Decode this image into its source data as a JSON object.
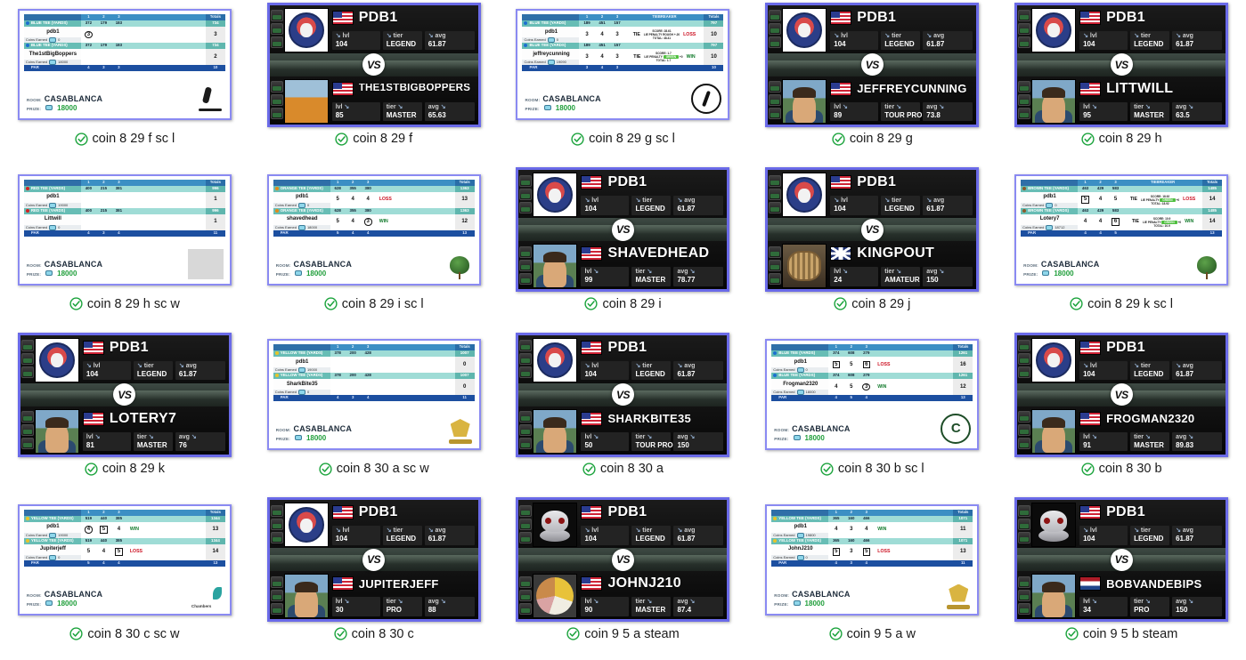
{
  "page": {
    "title": "Thumbnail grid of golf match screenshots",
    "rows": 4,
    "columns": 5,
    "accent_border": "#7b7bf0",
    "check_color": "#1ba33c"
  },
  "common": {
    "room_key": "ROOM:",
    "prize_key": "PRIZE:",
    "room": "CASABLANCA",
    "prize": "18000",
    "hole_headers": [
      "1",
      "2",
      "3"
    ],
    "totals_header": "Totals",
    "tiebreaker_header": "TIEBREAKER",
    "par_label": "PAR",
    "coins_label": "Coins Earned",
    "lvl_key": "lvl",
    "tier_key": "tier",
    "avg_key": "avg",
    "vs_label": "VS",
    "win": "WIN",
    "loss": "LOSS",
    "tie": "TIE"
  },
  "me": {
    "name": "PDB1",
    "name_lower": "pdb1",
    "flag": "us",
    "lvl": "104",
    "tier": "LEGEND",
    "avg": "61.87"
  },
  "items": [
    {
      "caption": "coin 8 29 f sc l",
      "type": "scorecard",
      "tee": "BLUE TEE (YARDS)",
      "tee_color": "#1d6fd0",
      "tiebreaker": false,
      "yards": [
        "372",
        "179",
        "183"
      ],
      "yards_total": "734",
      "par": [
        "4",
        "3",
        "3"
      ],
      "par_total": "10",
      "logo": "golfer",
      "players": [
        {
          "name": "pdb1",
          "scores": [
            "3",
            "",
            ""
          ],
          "marks": [
            "circle",
            "",
            ""
          ],
          "result": "",
          "total": "3",
          "coins": "0"
        },
        {
          "name": "The1stBigBoppers",
          "scores": [
            "",
            "",
            ""
          ],
          "marks": [
            "",
            "",
            ""
          ],
          "result": "",
          "total": "2",
          "coins": "18000"
        }
      ]
    },
    {
      "caption": "coin 8 29 f",
      "type": "vs",
      "avatar_me": "logo",
      "opponent": {
        "name": "THE1STBIGBOPPERS",
        "flag": "us",
        "lvl": "85",
        "tier": "MASTER",
        "avg": "65.63",
        "avatar": "monk"
      }
    },
    {
      "caption": "coin 8 29 g sc l",
      "type": "scorecard",
      "tee": "BLUE TEE (YARDS)",
      "tee_color": "#1d6fd0",
      "tiebreaker": true,
      "yards": [
        "189",
        "451",
        "157"
      ],
      "yards_total": "797",
      "par": [
        "3",
        "4",
        "3"
      ],
      "par_total": "10",
      "logo": "tiger",
      "players": [
        {
          "name": "pdb1",
          "scores": [
            "3",
            "4",
            "3"
          ],
          "marks": [
            "",
            "",
            ""
          ],
          "result": "LOSS",
          "tie": "TIE",
          "tb": [
            "SCORE: 28.61",
            "LIE PENALTY  ROUGH  +.20",
            "TOTAL: 48.41"
          ],
          "tb_pill": "",
          "total": "10",
          "coins": "0"
        },
        {
          "name": "jeffreycunning",
          "scores": [
            "3",
            "4",
            "3"
          ],
          "marks": [
            "",
            "",
            ""
          ],
          "result": "WIN",
          "tie": "TIE",
          "tb": [
            "SCORE: 1.7",
            "LIE PENALTY",
            "TOTAL: 1.7"
          ],
          "tb_pill": "GREEN",
          "total": "10",
          "coins": "19090"
        }
      ]
    },
    {
      "caption": "coin 8 29 g",
      "type": "vs",
      "avatar_me": "logo",
      "opponent": {
        "name": "JEFFREYCUNNING",
        "flag": "us",
        "lvl": "89",
        "tier": "TOUR PRO",
        "avg": "73.8",
        "avatar": "face"
      }
    },
    {
      "caption": "coin 8 29 h",
      "type": "vs",
      "avatar_me": "logo",
      "opponent": {
        "name": "LITTWILL",
        "flag": "us",
        "lvl": "95",
        "tier": "MASTER",
        "avg": "63.5",
        "avatar": "face"
      }
    },
    {
      "caption": "coin 8 29 h sc w",
      "type": "scorecard",
      "tee": "RED TEE (YARDS)",
      "tee_color": "#d02424",
      "tiebreaker": false,
      "yards": [
        "400",
        "215",
        "381"
      ],
      "yards_total": "996",
      "par": [
        "4",
        "3",
        "4"
      ],
      "par_total": "11",
      "logo": "blank",
      "players": [
        {
          "name": "pdb1",
          "scores": [
            "",
            "",
            ""
          ],
          "marks": [
            "",
            "",
            ""
          ],
          "result": "",
          "total": "1",
          "coins": "19000"
        },
        {
          "name": "Littwill",
          "scores": [
            "",
            "",
            ""
          ],
          "marks": [
            "",
            "",
            ""
          ],
          "result": "",
          "total": "1",
          "coins": "0"
        }
      ]
    },
    {
      "caption": "coin 8 29 i sc l",
      "type": "scorecard",
      "tee": "ORANGE TEE (YARDS)",
      "tee_color": "#e08a18",
      "tiebreaker": false,
      "yards": [
        "628",
        "355",
        "380"
      ],
      "yards_total": "1363",
      "par": [
        "5",
        "4",
        "4"
      ],
      "par_total": "13",
      "logo": "tree",
      "players": [
        {
          "name": "pdb1",
          "scores": [
            "5",
            "4",
            "4"
          ],
          "marks": [
            "",
            "",
            ""
          ],
          "result": "LOSS",
          "total": "13",
          "coins": "0"
        },
        {
          "name": "shavedhead",
          "scores": [
            "5",
            "4",
            "3"
          ],
          "marks": [
            "",
            "",
            "circle"
          ],
          "result": "WIN",
          "total": "12",
          "coins": "18000"
        }
      ]
    },
    {
      "caption": "coin 8 29 i",
      "type": "vs",
      "avatar_me": "logo",
      "opponent": {
        "name": "SHAVEDHEAD",
        "flag": "us",
        "lvl": "99",
        "tier": "MASTER",
        "avg": "78.77",
        "avatar": "face"
      }
    },
    {
      "caption": "coin 8 29 j",
      "type": "vs",
      "avatar_me": "logo",
      "opponent": {
        "name": "KINGPOUT",
        "flag": "uk",
        "lvl": "24",
        "tier": "AMATEUR",
        "avg": "150",
        "avatar": "king"
      }
    },
    {
      "caption": "coin 8 29 k sc l",
      "type": "scorecard",
      "tee": "BROWN TEE (YARDS)",
      "tee_color": "#8a5a2b",
      "tiebreaker": true,
      "yards": [
        "463",
        "429",
        "583"
      ],
      "yards_total": "1485",
      "par": [
        "4",
        "4",
        "5"
      ],
      "par_total": "13",
      "logo": "tree",
      "players": [
        {
          "name": "pdb1",
          "scores": [
            "5",
            "4",
            "5"
          ],
          "marks": [
            "box",
            "",
            ""
          ],
          "result": "LOSS",
          "tie": "TIE",
          "tb": [
            "SCORE: 18.92",
            "LIE PENALTY  GREEN  +0",
            "TOTAL: 18.92"
          ],
          "tb_pill": "GREEN",
          "total": "14",
          "coins": "0"
        },
        {
          "name": "Lotery7",
          "scores": [
            "4",
            "4",
            "6"
          ],
          "marks": [
            "",
            "",
            "box"
          ],
          "result": "WIN",
          "tie": "TIE",
          "tb": [
            "SCORE: 10.9",
            "LIE PENALTY  GREEN  +0",
            "TOTAL: 10.9"
          ],
          "tb_pill": "GREEN",
          "total": "14",
          "coins": "18712"
        }
      ]
    },
    {
      "caption": "coin 8 29 k",
      "type": "vs",
      "avatar_me": "logo",
      "opponent": {
        "name": "LOTERY7",
        "flag": "us",
        "lvl": "81",
        "tier": "MASTER",
        "avg": "76",
        "avatar": "face"
      }
    },
    {
      "caption": "coin 8 30 a sc w",
      "type": "scorecard",
      "tee": "YELLOW TEE (YARDS)",
      "tee_color": "#e8c428",
      "tiebreaker": false,
      "yards": [
        "378",
        "200",
        "428"
      ],
      "yards_total": "1007",
      "par": [
        "4",
        "3",
        "4"
      ],
      "par_total": "11",
      "logo": "crest",
      "players": [
        {
          "name": "pdb1",
          "scores": [
            "",
            "",
            ""
          ],
          "marks": [
            "",
            "",
            ""
          ],
          "result": "",
          "total": "0",
          "coins": "19000"
        },
        {
          "name": "SharkBite35",
          "scores": [
            "",
            "",
            ""
          ],
          "marks": [
            "",
            "",
            ""
          ],
          "result": "",
          "total": "0",
          "coins": "0"
        }
      ]
    },
    {
      "caption": "coin 8 30 a",
      "type": "vs",
      "avatar_me": "logo",
      "opponent": {
        "name": "SHARKBITE35",
        "flag": "us",
        "lvl": "50",
        "tier": "TOUR PRO",
        "avg": "150",
        "avatar": "face"
      }
    },
    {
      "caption": "coin 8 30 b sc l",
      "type": "scorecard",
      "tee": "BLUE TEE (YARDS)",
      "tee_color": "#1d6fd0",
      "tiebreaker": false,
      "yards": [
        "374",
        "608",
        "279"
      ],
      "yards_total": "1261",
      "par": [
        "4",
        "5",
        "4"
      ],
      "par_total": "13",
      "logo": "c",
      "players": [
        {
          "name": "pdb1",
          "scores": [
            "5",
            "5",
            "6"
          ],
          "marks": [
            "box",
            "",
            "box"
          ],
          "result": "LOSS",
          "total": "16",
          "coins": "0"
        },
        {
          "name": "Frogman2320",
          "scores": [
            "4",
            "5",
            "3"
          ],
          "marks": [
            "",
            "",
            "circle"
          ],
          "result": "WIN",
          "total": "12",
          "coins": "18000"
        }
      ]
    },
    {
      "caption": "coin 8 30 b",
      "type": "vs",
      "avatar_me": "logo",
      "opponent": {
        "name": "FROGMAN2320",
        "flag": "us",
        "lvl": "91",
        "tier": "MASTER",
        "avg": "89.83",
        "avatar": "face"
      }
    },
    {
      "caption": "coin 8 30 c sc w",
      "type": "scorecard",
      "tee": "YELLOW TEE (YARDS)",
      "tee_color": "#e8c428",
      "tiebreaker": false,
      "yards": [
        "519",
        "440",
        "385"
      ],
      "yards_total": "1344",
      "par": [
        "5",
        "4",
        "4"
      ],
      "par_total": "13",
      "logo": "chambers",
      "players": [
        {
          "name": "pdb1",
          "scores": [
            "4",
            "5",
            "4"
          ],
          "marks": [
            "circle",
            "box",
            ""
          ],
          "result": "WIN",
          "total": "13",
          "coins": "19000"
        },
        {
          "name": "Jupiterjeff",
          "scores": [
            "5",
            "4",
            "5"
          ],
          "marks": [
            "",
            "",
            "box"
          ],
          "result": "LOSS",
          "total": "14",
          "coins": "0"
        }
      ]
    },
    {
      "caption": "coin 8 30 c",
      "type": "vs",
      "avatar_me": "logo",
      "opponent": {
        "name": "JUPITERJEFF",
        "flag": "us",
        "lvl": "30",
        "tier": "PRO",
        "avg": "88",
        "avatar": "face"
      }
    },
    {
      "caption": "coin 9 5 a steam",
      "type": "vs",
      "avatar_me": "skull",
      "opponent": {
        "name": "JOHNJ210",
        "flag": "us",
        "lvl": "90",
        "tier": "MASTER",
        "avg": "87.4",
        "avatar": "pie"
      }
    },
    {
      "caption": "coin 9 5 a w",
      "type": "scorecard",
      "tee": "YELLOW TEE (YARDS)",
      "tee_color": "#e8c428",
      "tiebreaker": false,
      "yards": [
        "365",
        "160",
        "466"
      ],
      "yards_total": "1071",
      "par": [
        "4",
        "3",
        "4"
      ],
      "par_total": "11",
      "logo": "crest",
      "players": [
        {
          "name": "pdb1",
          "scores": [
            "4",
            "3",
            "4"
          ],
          "marks": [
            "",
            "",
            ""
          ],
          "result": "WIN",
          "total": "11",
          "coins": "19800"
        },
        {
          "name": "JohnJ210",
          "scores": [
            "5",
            "3",
            "5"
          ],
          "marks": [
            "box",
            "",
            "box"
          ],
          "result": "LOSS",
          "total": "13",
          "coins": "0"
        }
      ]
    },
    {
      "caption": "coin 9 5 b steam",
      "type": "vs",
      "avatar_me": "skull",
      "opponent": {
        "name": "BOBVANDEBIPS",
        "flag": "nl",
        "lvl": "34",
        "tier": "PRO",
        "avg": "150",
        "avatar": "face"
      }
    }
  ]
}
